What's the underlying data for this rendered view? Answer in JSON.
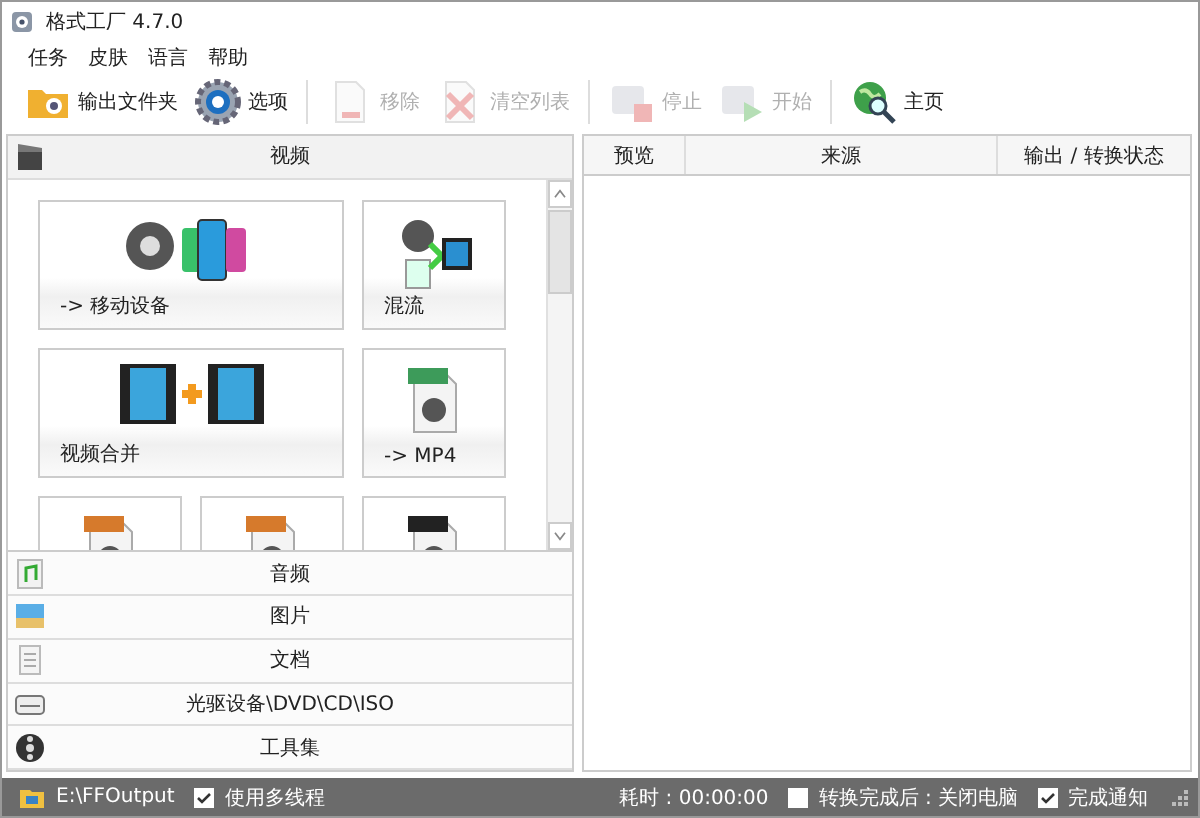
{
  "window": {
    "title": "格式工厂 4.7.0"
  },
  "menu": [
    "任务",
    "皮肤",
    "语言",
    "帮助"
  ],
  "toolbar": [
    {
      "label": "输出文件夹",
      "disabled": false
    },
    {
      "label": "选项",
      "disabled": false
    },
    {
      "label": "移除",
      "disabled": true
    },
    {
      "label": "清空列表",
      "disabled": true
    },
    {
      "label": "停止",
      "disabled": true
    },
    {
      "label": "开始",
      "disabled": true
    },
    {
      "label": "主页",
      "disabled": false
    }
  ],
  "left_panel": {
    "header": "视频",
    "tiles": [
      {
        "kind": "wide",
        "label": "-> 移动设备"
      },
      {
        "kind": "small",
        "label": "混流"
      },
      {
        "kind": "wide",
        "label": "视频合并"
      },
      {
        "kind": "small",
        "label": "-> MP4"
      },
      {
        "kind": "small"
      },
      {
        "kind": "small"
      },
      {
        "kind": "small"
      }
    ],
    "categories": [
      "音频",
      "图片",
      "文档",
      "光驱设备\\DVD\\CD\\ISO",
      "工具集"
    ]
  },
  "task_table": {
    "columns": [
      "预览",
      "来源",
      "输出 / 转换状态"
    ]
  },
  "status_bar": {
    "output_folder": "E:\\FFOutput",
    "multithread": {
      "label": "使用多线程",
      "checked": true
    },
    "elapsed": "耗时 : 00:00:00",
    "shutdown": {
      "label": "转换完成后 : 关闭电脑",
      "checked": false
    },
    "notify": {
      "label": "完成通知",
      "checked": true
    }
  }
}
